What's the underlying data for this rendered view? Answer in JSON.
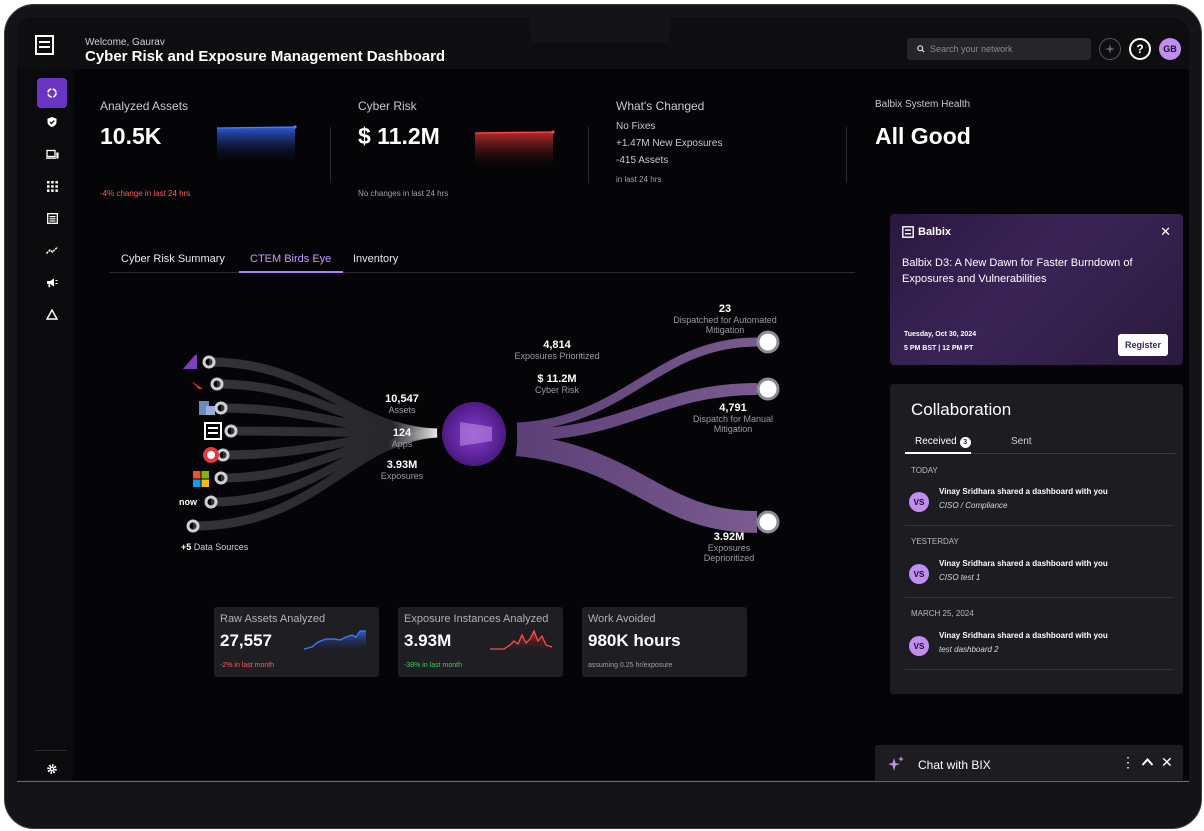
{
  "header": {
    "welcome": "Welcome, Gaurav",
    "title": "Cyber Risk and Exposure Management Dashboard",
    "search_placeholder": "Search your network",
    "avatar_initials": "GB",
    "help": "?"
  },
  "sidebar": {
    "items": [
      "dashboard-icon",
      "shield-check-icon",
      "devices-icon",
      "apps-grid-icon",
      "list-icon",
      "trend-icon",
      "megaphone-icon",
      "warning-triangle-icon"
    ],
    "settings": "gear-icon"
  },
  "metrics": {
    "analyzed_assets": {
      "label": "Analyzed Assets",
      "value": "10.5K",
      "sub": "-4% change in last 24 hrs"
    },
    "cyber_risk": {
      "label": "Cyber Risk",
      "value": "$ 11.2M",
      "sub": "No changes in last 24 hrs"
    },
    "whats_changed": {
      "label": "What's Changed",
      "line1": "No Fixes",
      "line2": "+1.47M New Exposures",
      "line3": "-415 Assets",
      "sub": "in last 24 hrs"
    },
    "system_health": {
      "label": "Balbix System Health",
      "value": "All Good"
    }
  },
  "tabs": [
    "Cyber Risk Summary",
    "CTEM Birds Eye",
    "Inventory"
  ],
  "flow": {
    "sources_more": "+5",
    "sources_label": "Data Sources",
    "assets_value": "10,547",
    "assets_label": "Assets",
    "apps_value": "124",
    "apps_label": "Apps",
    "exposures_value": "3.93M",
    "exposures_label": "Exposures",
    "prioritized_value": "4,814",
    "prioritized_label": "Exposures Prioritized",
    "risk_value": "$ 11.2M",
    "risk_label": "Cyber Risk",
    "automated_value": "23",
    "automated_label_1": "Dispatched for Automated",
    "automated_label_2": "Mitigation",
    "manual_value": "4,791",
    "manual_label_1": "Dispatch for Manual",
    "manual_label_2": "Mitigation",
    "deprioritized_value": "3.92M",
    "deprioritized_label_1": "Exposures",
    "deprioritized_label_2": "Deprioritized"
  },
  "cards": [
    {
      "label": "Raw Assets Analyzed",
      "value": "27,557",
      "sub": "-2% in last month",
      "sub_color": "#ff5b5b",
      "spark_color": "#3f7bff"
    },
    {
      "label": "Exposure Instances Analyzed",
      "value": "3.93M",
      "sub": "-38% in last month",
      "sub_color": "#3ecf5b",
      "spark_color": "#ff4a4a"
    },
    {
      "label": "Work Avoided",
      "value": "980K hours",
      "sub": "assuming 0.25 hr/exposure",
      "sub_color": "#a0a0a8"
    }
  ],
  "promo": {
    "brand": "Balbix",
    "title": "Balbix D3: A New Dawn for Faster Burndown of Exposures and Vulnerabilities",
    "date": "Tuesday, Oct 30, 2024",
    "time": "5 PM BST | 12 PM PT",
    "button": "Register"
  },
  "collaboration": {
    "title": "Collaboration",
    "tab_received": "Received",
    "received_count": "3",
    "tab_sent": "Sent",
    "groups": [
      {
        "label": "TODAY",
        "text": "Vinay Sridhara shared a dashboard with you",
        "sub": "CISO / Compliance",
        "initials": "VS"
      },
      {
        "label": "YESTERDAY",
        "text": "Vinay Sridhara shared a dashboard with you",
        "sub": "CISO test 1",
        "initials": "VS"
      },
      {
        "label": "MARCH 25, 2024",
        "text": "Vinay Sridhara shared a dashboard with you",
        "sub": "test dashboard 2",
        "initials": "VS"
      }
    ]
  },
  "chat": {
    "label": "Chat with BIX"
  }
}
